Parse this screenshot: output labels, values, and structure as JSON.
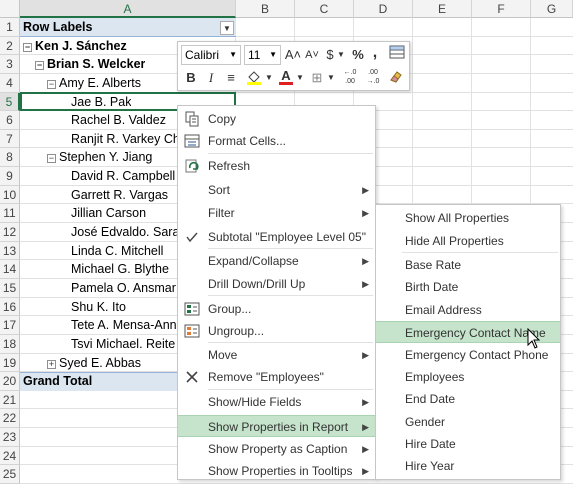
{
  "columns": [
    "A",
    "B",
    "C",
    "D",
    "E",
    "F",
    "G"
  ],
  "rows": [
    "1",
    "2",
    "3",
    "4",
    "5",
    "6",
    "7",
    "8",
    "9",
    "10",
    "11",
    "12",
    "13",
    "14",
    "15",
    "16",
    "17",
    "18",
    "19",
    "20",
    "21",
    "22",
    "23",
    "24",
    "25"
  ],
  "pivot": {
    "header": "Row Labels",
    "items": [
      {
        "text": "Ken J. Sánchez",
        "expander": "−"
      },
      {
        "text": "Brian S. Welcker",
        "expander": "−"
      },
      {
        "text": "Amy E. Alberts",
        "expander": "−"
      },
      {
        "text": "Jae B. Pak",
        "expander": ""
      },
      {
        "text": "Rachel B. Valdez",
        "expander": ""
      },
      {
        "text": "Ranjit R. Varkey Ch",
        "expander": ""
      },
      {
        "text": "Stephen Y. Jiang",
        "expander": "−"
      },
      {
        "text": "David R. Campbell",
        "expander": ""
      },
      {
        "text": "Garrett R. Vargas",
        "expander": ""
      },
      {
        "text": "Jillian Carson",
        "expander": ""
      },
      {
        "text": "José Edvaldo. Sara",
        "expander": ""
      },
      {
        "text": "Linda C. Mitchell",
        "expander": ""
      },
      {
        "text": "Michael G. Blythe",
        "expander": ""
      },
      {
        "text": "Pamela O. Ansmar",
        "expander": ""
      },
      {
        "text": "Shu K. Ito",
        "expander": ""
      },
      {
        "text": "Tete A. Mensa-Ann",
        "expander": ""
      },
      {
        "text": "Tsvi Michael. Reite",
        "expander": ""
      },
      {
        "text": "Syed E. Abbas",
        "expander": "+"
      }
    ],
    "grand_total": "Grand Total"
  },
  "minitoolbar": {
    "font": "Calibri",
    "size": "11",
    "grow": "A˄",
    "shrink": "A˅",
    "currency": "$",
    "percent": "%",
    "comma": ",",
    "bold": "B",
    "italic": "I",
    "align": "≡",
    "font_color": "A",
    "borders": "⊞",
    "inc_decimal": "←.0\n.00",
    "dec_decimal": ".00\n→.0"
  },
  "context_menu": [
    {
      "label": "Copy",
      "icon": "copy-icon"
    },
    {
      "label": "Format Cells...",
      "icon": "format-cells-icon"
    },
    {
      "label": "Refresh",
      "icon": "refresh-icon"
    },
    {
      "label": "Sort",
      "submenu": true
    },
    {
      "label": "Filter",
      "submenu": true
    },
    {
      "label": "Subtotal \"Employee Level 05\"",
      "icon": "checkmark-icon"
    },
    {
      "label": "Expand/Collapse",
      "submenu": true
    },
    {
      "label": "Drill Down/Drill Up",
      "submenu": true
    },
    {
      "label": "Group...",
      "icon": "group-icon"
    },
    {
      "label": "Ungroup...",
      "icon": "ungroup-icon"
    },
    {
      "label": "Move",
      "submenu": true
    },
    {
      "label": "Remove \"Employees\"",
      "icon": "remove-icon"
    },
    {
      "label": "Show/Hide Fields",
      "submenu": true
    },
    {
      "label": "Show Properties in Report",
      "submenu": true,
      "highlighted": true
    },
    {
      "label": "Show Property as Caption",
      "submenu": true
    },
    {
      "label": "Show Properties in Tooltips",
      "submenu": true
    }
  ],
  "submenu": [
    "Show All Properties",
    "Hide All Properties",
    "Base Rate",
    "Birth Date",
    "Email Address",
    "Emergency Contact Name",
    "Emergency Contact Phone",
    "Employees",
    "End Date",
    "Gender",
    "Hire Date",
    "Hire Year"
  ],
  "colors": {
    "accent": "#217346",
    "pivot_band": "#dce6f1",
    "menu_highlight": "#c6e4cc"
  }
}
